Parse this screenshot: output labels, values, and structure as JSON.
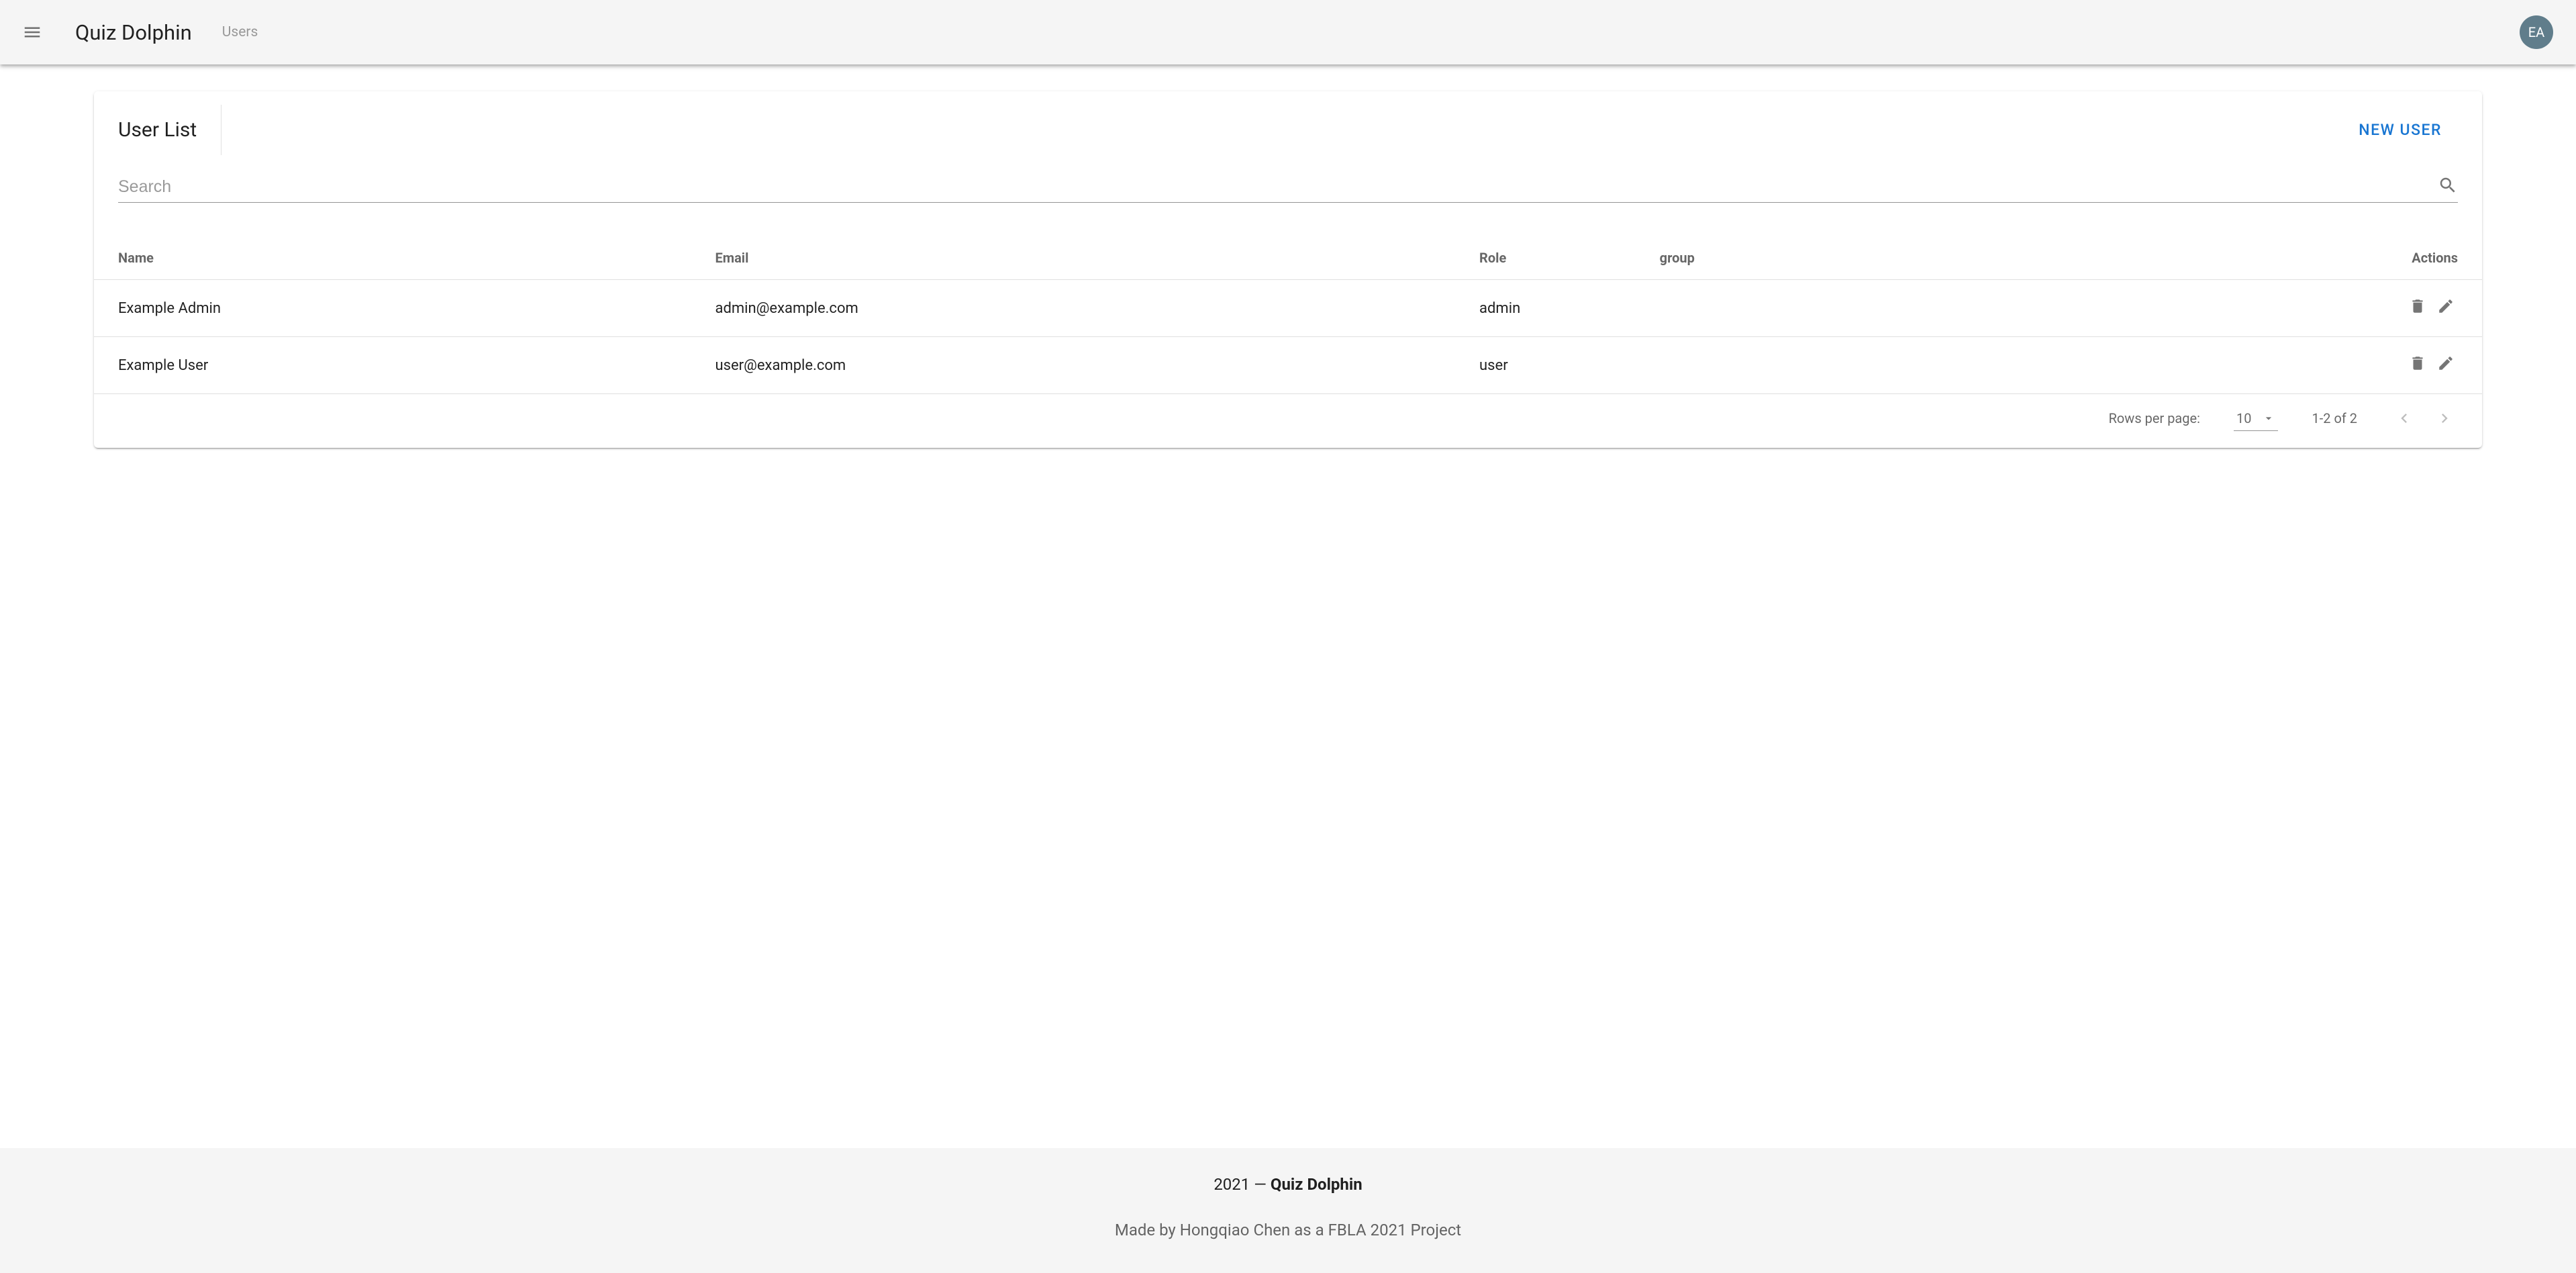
{
  "header": {
    "app_title": "Quiz Dolphin",
    "breadcrumb": "Users",
    "avatar_initials": "EA"
  },
  "card": {
    "tab_title": "User List",
    "new_user_label": "New User",
    "search_placeholder": "Search"
  },
  "table": {
    "headers": {
      "name": "Name",
      "email": "Email",
      "role": "Role",
      "group": "group",
      "actions": "Actions"
    },
    "rows": [
      {
        "name": "Example Admin",
        "email": "admin@example.com",
        "role": "admin",
        "group": ""
      },
      {
        "name": "Example User",
        "email": "user@example.com",
        "role": "user",
        "group": ""
      }
    ]
  },
  "pagination": {
    "rows_per_page_label": "Rows per page:",
    "rows_per_page_value": "10",
    "range_text": "1-2 of 2"
  },
  "footer": {
    "year_prefix": "2021 — ",
    "brand": "Quiz Dolphin",
    "credit": "Made by Hongqiao Chen as a FBLA 2021 Project"
  }
}
